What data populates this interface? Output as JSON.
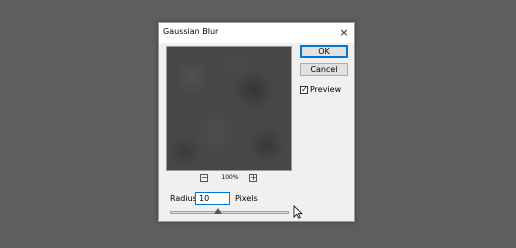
{
  "dialog": {
    "title": "Gaussian Blur",
    "close_symbol": "×"
  },
  "preview": {
    "zoom_out_symbol": "−",
    "zoom_in_symbol": "+",
    "zoom_level": "100%",
    "enabled": true
  },
  "buttons": {
    "ok_label": "OK",
    "cancel_label": "Cancel"
  },
  "preview_checkbox": {
    "label": "Preview",
    "check_mark": "✓"
  },
  "radius": {
    "label": "Radius:",
    "value": "10",
    "unit": "Pixels",
    "slider_position": 0.4
  },
  "colors": {
    "desktop_background": "#5e5e5e",
    "dialog_background": "#f0f0f0",
    "accent": "#0078d7",
    "preview_fill": "#474747"
  },
  "icons": {
    "close": "close-icon",
    "zoom_out": "zoom-out-icon",
    "zoom_in": "zoom-in-icon",
    "checkbox": "checkmark-icon",
    "slider_thumb": "triangle-up-icon",
    "mouse": "mouse-pointer-icon"
  }
}
